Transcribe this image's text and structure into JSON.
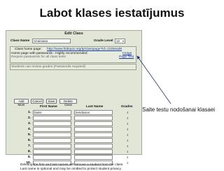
{
  "slide": {
    "title": "Labot klases iestatījumus"
  },
  "panel": {
    "title": "Edit Class",
    "class_name_label": "Class Name",
    "class_name_value": "ninaiaiaaa",
    "grade_level_label": "Grade Level",
    "grade_level_value": "12",
    "home_page_label": "Class home page:",
    "home_page_url": "http://www.fridiquiz.org/tp/classpage?id=1230ead8",
    "image_link": "Image",
    "page_text_link": "Page Text",
    "option_home_passwords": "Home page with passwords - Highly recommended",
    "option_require_passwords": "Require passwords for all class tests",
    "option_students_review": "Students can review grades (Passwords required)",
    "buttons": [
      "Add More",
      "Cancel",
      "Save",
      "Delete Class"
    ],
    "columns": {
      "first_name": "First Name",
      "last_name": "Last Name",
      "grades": "Grades"
    },
    "students": [
      {
        "num": "1.",
        "first": "bains",
        "last": "bendixson",
        "grade": "4"
      },
      {
        "num": "2.",
        "first": "",
        "last": "",
        "grade": "4"
      },
      {
        "num": "3.",
        "first": "",
        "last": "",
        "grade": "4"
      },
      {
        "num": "4.",
        "first": "",
        "last": "",
        "grade": "4"
      },
      {
        "num": "5.",
        "first": "",
        "last": "",
        "grade": "4"
      },
      {
        "num": "6.",
        "first": "",
        "last": "",
        "grade": "4"
      },
      {
        "num": "7.",
        "first": "",
        "last": "",
        "grade": "4"
      },
      {
        "num": "8.",
        "first": "",
        "last": "",
        "grade": "4"
      },
      {
        "num": "9.",
        "first": "",
        "last": "",
        "grade": "4"
      },
      {
        "num": "10.",
        "first": "",
        "last": "",
        "grade": "4"
      }
    ],
    "footer_line1": "Deleting the first and last names will remove a student from the class.",
    "footer_line2": "Last name is optional and may be omitted to protect student privacy."
  },
  "annotation": {
    "caption": "Saite testu nodošanai klasaei"
  },
  "colors": {
    "panel_bg": "#e1e6d7",
    "link": "#1a3c9c",
    "arrow": "#1f2f78"
  }
}
